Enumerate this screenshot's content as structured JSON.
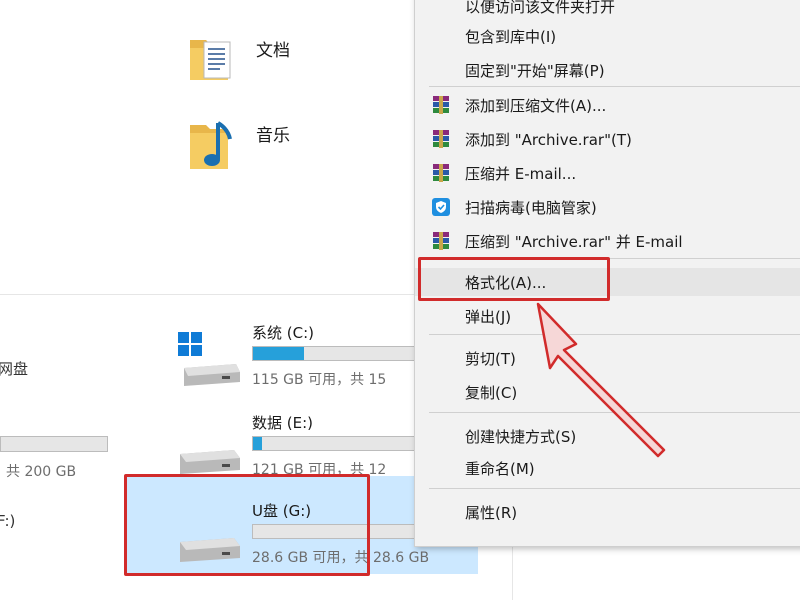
{
  "explorer": {
    "folders": [
      {
        "name": "文档",
        "icon": "documents-folder-icon"
      },
      {
        "name": "音乐",
        "icon": "music-folder-icon"
      }
    ],
    "left_partial": {
      "network_drive_label": "网盘",
      "left_drive_free": "共 200 GB",
      "left_drive_letter": "F:)"
    },
    "drives": [
      {
        "name": "系统 (C:)",
        "free": "115 GB 可用，共 15",
        "used_fraction": 0.17,
        "icon": "windows-drive-icon"
      },
      {
        "name": "数据 (E:)",
        "free": "121 GB 可用，共 12",
        "used_fraction": 0.03,
        "icon": "hard-drive-icon"
      },
      {
        "name": "U盘 (G:)",
        "free": "28.6 GB 可用，共 28.6 GB",
        "used_fraction": 0.0,
        "icon": "usb-drive-icon"
      }
    ]
  },
  "context_menu": {
    "items": [
      {
        "label": "以便访问该文件夹打开"
      },
      {
        "label": "包含到库中(I)"
      },
      {
        "label": "固定到\"开始\"屏幕(P)"
      },
      {
        "label": "添加到压缩文件(A)...",
        "icon": "winrar-icon"
      },
      {
        "label": "添加到 \"Archive.rar\"(T)",
        "icon": "winrar-icon"
      },
      {
        "label": "压缩并 E-mail...",
        "icon": "winrar-icon"
      },
      {
        "label": "扫描病毒(电脑管家)",
        "icon": "shield-icon"
      },
      {
        "label": "压缩到 \"Archive.rar\" 并 E-mail",
        "icon": "winrar-icon"
      },
      {
        "label": "格式化(A)..."
      },
      {
        "label": "弹出(J)"
      },
      {
        "label": "剪切(T)"
      },
      {
        "label": "复制(C)"
      },
      {
        "label": "创建快捷方式(S)"
      },
      {
        "label": "重命名(M)"
      },
      {
        "label": "属性(R)"
      }
    ]
  },
  "annotation": {
    "color": "#d12b2b"
  },
  "colors": {
    "selection": "#cce8ff",
    "menu_bg": "#f2f2f2",
    "bar_fill": "#26a0da"
  }
}
